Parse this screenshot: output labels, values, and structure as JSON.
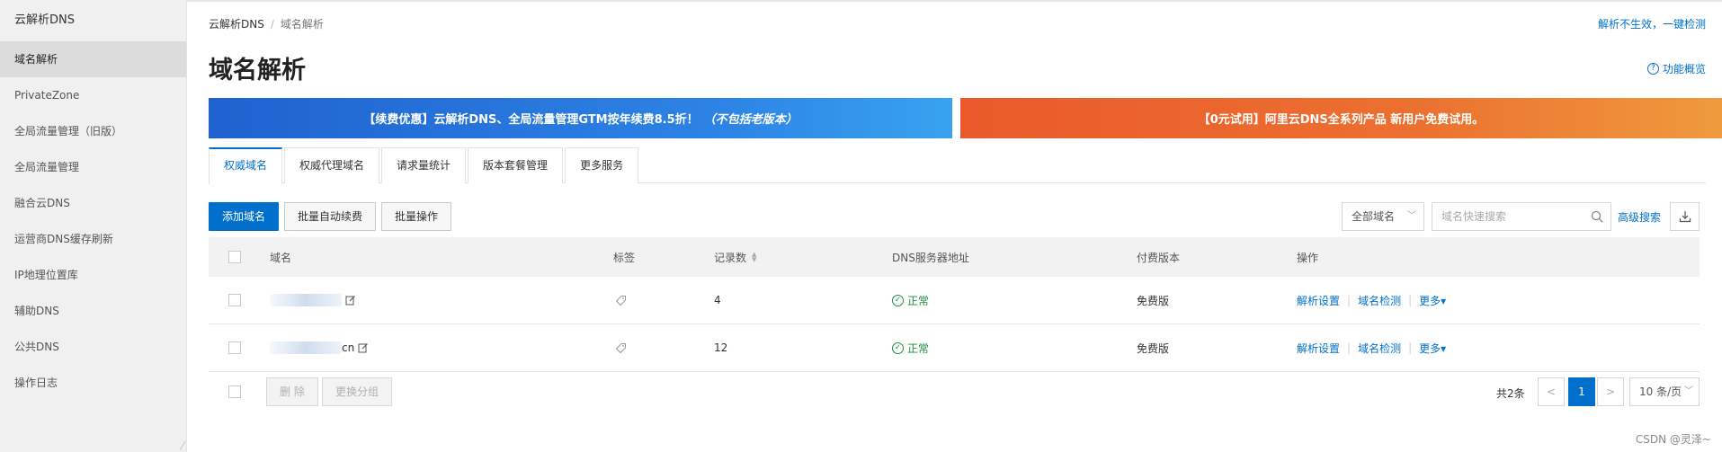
{
  "sidebar": {
    "title": "云解析DNS",
    "items": [
      {
        "label": "域名解析",
        "active": true
      },
      {
        "label": "PrivateZone"
      },
      {
        "label": "全局流量管理（旧版）"
      },
      {
        "label": "全局流量管理"
      },
      {
        "label": "融合云DNS"
      },
      {
        "label": "运营商DNS缓存刷新"
      },
      {
        "label": "IP地理位置库"
      },
      {
        "label": "辅助DNS"
      },
      {
        "label": "公共DNS"
      },
      {
        "label": "操作日志"
      }
    ]
  },
  "header": {
    "breadcrumb": [
      "云解析DNS",
      "域名解析"
    ],
    "breadcrumb_sep": "/",
    "top_right_link": "解析不生效，一键检测",
    "title": "域名解析",
    "help_link": "功能概览"
  },
  "banners": {
    "blue_text": "【续费优惠】云解析DNS、全局流量管理GTM按年续费8.5折！",
    "blue_italic": "（不包括老版本）",
    "orange_text": "【0元试用】阿里云DNS全系列产品 新用户免费试用。"
  },
  "tabs": [
    {
      "label": "权威域名",
      "active": true
    },
    {
      "label": "权威代理域名"
    },
    {
      "label": "请求量统计"
    },
    {
      "label": "版本套餐管理"
    },
    {
      "label": "更多服务"
    }
  ],
  "toolbar": {
    "add_domain": "添加域名",
    "batch_renew": "批量自动续费",
    "batch_ops": "批量操作",
    "domain_filter": "全部域名",
    "search_placeholder": "域名快速搜索",
    "advanced_search": "高级搜索"
  },
  "table": {
    "columns": {
      "domain": "域名",
      "tag": "标签",
      "records": "记录数",
      "dns_server": "DNS服务器地址",
      "edition": "付费版本",
      "actions": "操作"
    },
    "rows": [
      {
        "domain_suffix": "",
        "records": "4",
        "status": "正常",
        "edition": "免费版",
        "op1": "解析设置",
        "op2": "域名检测",
        "op3": "更多"
      },
      {
        "domain_suffix": "cn",
        "records": "12",
        "status": "正常",
        "edition": "免费版",
        "op1": "解析设置",
        "op2": "域名检测",
        "op3": "更多"
      }
    ]
  },
  "footer": {
    "delete": "删 除",
    "change_group": "更换分组",
    "total": "共2条",
    "prev": "<",
    "current_page": "1",
    "next": ">",
    "page_size": "10 条/页"
  },
  "colors": {
    "accent": "#0070cc",
    "status_ok": "#1e8e3e",
    "banner_blue": "#1f62cf",
    "banner_orange": "#ea5a2c"
  },
  "watermark": "CSDN @灵泽~"
}
